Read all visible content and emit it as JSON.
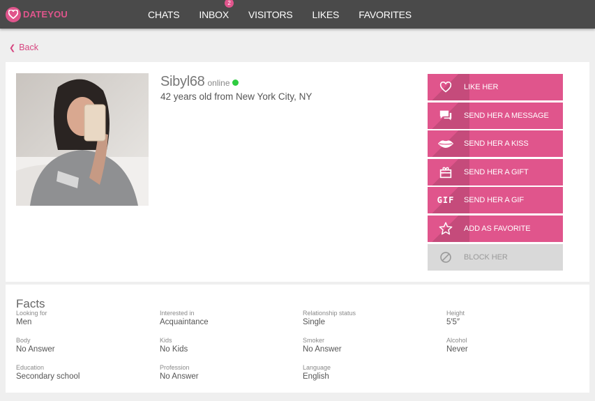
{
  "brand": {
    "name": "DATEYOU",
    "accent": "#e0558c"
  },
  "nav": {
    "items": [
      {
        "label": "CHATS"
      },
      {
        "label": "INBOX",
        "badge": "2"
      },
      {
        "label": "VISITORS"
      },
      {
        "label": "LIKES"
      },
      {
        "label": "FAVORITES"
      }
    ]
  },
  "back": {
    "label": "Back"
  },
  "profile": {
    "username": "Sibyl68",
    "status": "online",
    "summary": "42 years old from New York City, NY",
    "actions": [
      {
        "label": "LIKE HER",
        "icon": "heart-icon"
      },
      {
        "label": "SEND HER A MESSAGE",
        "icon": "chat-icon"
      },
      {
        "label": "SEND HER A KISS",
        "icon": "lips-icon"
      },
      {
        "label": "SEND HER A GIFT",
        "icon": "gift-icon"
      },
      {
        "label": "SEND HER A GIF",
        "icon": "gif-icon",
        "icon_text": "GIF"
      },
      {
        "label": "ADD AS FAVORITE",
        "icon": "star-icon"
      },
      {
        "label": "BLOCK HER",
        "icon": "block-icon"
      }
    ]
  },
  "facts": {
    "title": "Facts",
    "items": [
      {
        "label": "Looking for",
        "value": "Men"
      },
      {
        "label": "Interested in",
        "value": "Acquaintance"
      },
      {
        "label": "Relationship status",
        "value": "Single"
      },
      {
        "label": "Height",
        "value": "5′5″"
      },
      {
        "label": "Body",
        "value": "No Answer"
      },
      {
        "label": "Kids",
        "value": "No Kids"
      },
      {
        "label": "Smoker",
        "value": "No Answer"
      },
      {
        "label": "Alcohol",
        "value": "Never"
      },
      {
        "label": "Education",
        "value": "Secondary school"
      },
      {
        "label": "Profession",
        "value": "No Answer"
      },
      {
        "label": "Language",
        "value": "English"
      }
    ]
  }
}
